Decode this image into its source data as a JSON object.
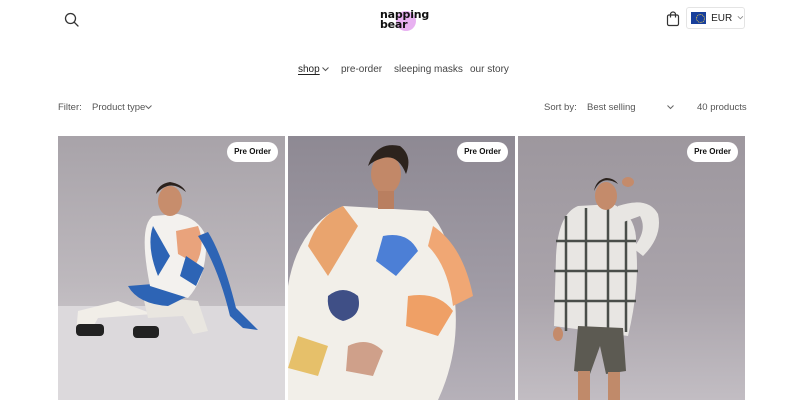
{
  "brand": {
    "line1": "napping",
    "line2": "bear",
    "accent": "#e6a8ef"
  },
  "header": {
    "search_icon": "search-icon",
    "cart_icon": "shopping-bag-icon",
    "currency": {
      "code": "EUR",
      "flag": "eu-flag-icon"
    }
  },
  "nav": {
    "items": [
      {
        "label": "shop",
        "active": true,
        "has_dropdown": true
      },
      {
        "label": "pre-order"
      },
      {
        "label": "sleeping masks"
      },
      {
        "label": "our story"
      }
    ]
  },
  "toolbar": {
    "filter_label": "Filter:",
    "filter_value": "Product type",
    "sort_label": "Sort by:",
    "sort_value": "Best selling",
    "count": "40 products"
  },
  "products": [
    {
      "badge": "Pre Order"
    },
    {
      "badge": "Pre Order"
    },
    {
      "badge": "Pre Order"
    }
  ]
}
